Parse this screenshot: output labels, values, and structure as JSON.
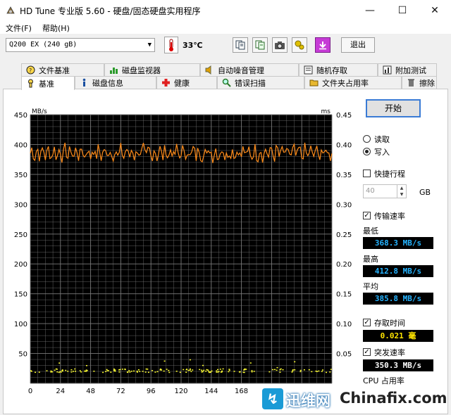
{
  "window": {
    "title": "HD Tune 专业版 5.60 - 硬盘/固态硬盘实用程序",
    "minimize": "—",
    "maximize": "☐",
    "close": "✕"
  },
  "menu": {
    "file": "文件(F)",
    "help": "帮助(H)"
  },
  "toolbar": {
    "drive": "Q200 EX (240 gB)",
    "temperature": "33℃",
    "exit_label": "退出",
    "icons": [
      "copy-icon",
      "copy-info-icon",
      "camera-icon",
      "options-icon",
      "download-icon"
    ]
  },
  "tabs_top": [
    "文件基准",
    "磁盘监视器",
    "自动噪音管理",
    "随机存取",
    "附加测试"
  ],
  "tabs_bottom": [
    "基准",
    "磁盘信息",
    "健康",
    "错误扫描",
    "文件夹占用率",
    "擦除"
  ],
  "active_tab": "基准",
  "controls": {
    "start": "开始",
    "read": "读取",
    "write": "写入",
    "mode_selected": "write",
    "short_stroke": "快捷行程",
    "short_stroke_checked": false,
    "short_stroke_value": "40",
    "gb_unit": "GB",
    "transfer_rate": "传输速率",
    "transfer_rate_checked": true,
    "min_label": "最低",
    "min_value": "368.3 MB/s",
    "max_label": "最高",
    "max_value": "412.8 MB/s",
    "avg_label": "平均",
    "avg_value": "385.8 MB/s",
    "access_time": "存取时间",
    "access_time_checked": true,
    "access_value": "0.021 毫",
    "burst_rate": "突发速率",
    "burst_rate_checked": true,
    "burst_value": "350.3 MB/s",
    "cpu_label": "CPU 占用率"
  },
  "colors": {
    "transfer_line": "#ff8c1a",
    "access_points": "#ffff33",
    "grid": "#7a7a7a",
    "plot_bg": "#000000",
    "readout_blue": "#25b3ff"
  },
  "chart_data": {
    "type": "line",
    "y_left_label": "MB/s",
    "y_right_label": "ms",
    "y_left_ticks": [
      "450",
      "400",
      "350",
      "300",
      "250",
      "200",
      "150",
      "100",
      "50"
    ],
    "y_right_ticks": [
      "0.45",
      "0.40",
      "0.35",
      "0.30",
      "0.25",
      "0.20",
      "0.15",
      "0.10",
      "0.05"
    ],
    "x_ticks": [
      "0",
      "24",
      "48",
      "72",
      "96",
      "120",
      "144",
      "168",
      "192"
    ],
    "ylim_left": [
      0,
      450
    ],
    "ylim_right": [
      0,
      0.45
    ],
    "xlim": [
      0,
      240
    ],
    "series": [
      {
        "name": "传输速率",
        "axis": "left",
        "min": 368.3,
        "max": 412.8,
        "avg": 385.8
      },
      {
        "name": "存取时间",
        "axis": "right",
        "typical": 0.021
      }
    ]
  },
  "watermark": {
    "brand_cn": "迅维网",
    "brand_en": "Chinafix.com"
  }
}
